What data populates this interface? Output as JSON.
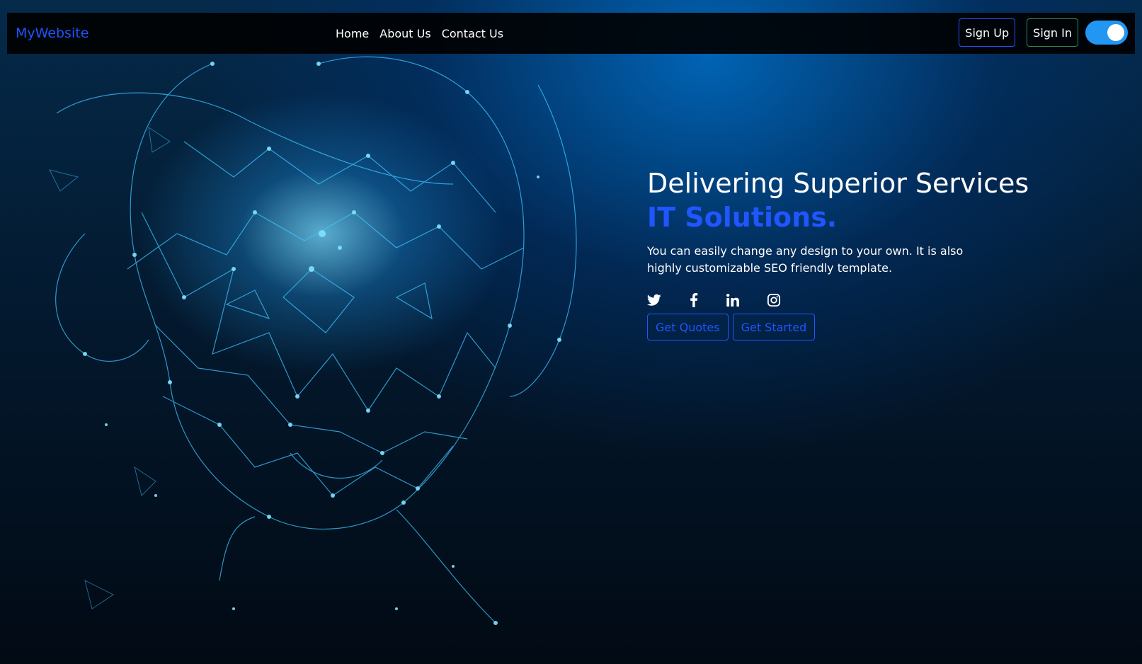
{
  "navbar": {
    "brand": "MyWebsite",
    "links": [
      "Home",
      "About Us",
      "Contact Us"
    ],
    "sign_up": "Sign Up",
    "sign_in": "Sign In",
    "toggle_on": true
  },
  "hero": {
    "title": "Delivering Superior Services",
    "subtitle": "IT Solutions.",
    "description": "You can easily change any design to your own. It is also highly customizable SEO friendly template.",
    "social_icons": [
      "twitter-icon",
      "facebook-icon",
      "linkedin-icon",
      "instagram-icon"
    ],
    "buttons": [
      "Get Quotes",
      "Get Started"
    ]
  },
  "colors": {
    "accent": "#1f56ff",
    "toggle": "#2196f3",
    "nav_bg": "#000000",
    "text": "#ffffff"
  }
}
